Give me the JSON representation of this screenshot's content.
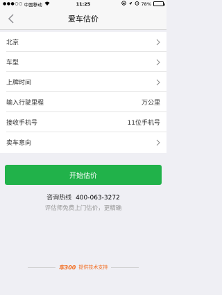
{
  "status_bar": {
    "signal": "●●●○○",
    "carrier": "中国移动",
    "wifi": "wifi-icon",
    "time": "11:25",
    "battery_text": "78%",
    "icons": [
      "lock-rotation-icon",
      "location-arrow-icon",
      "alarm-icon",
      "battery-icon"
    ]
  },
  "nav": {
    "title": "爱车估价",
    "back_icon": "chevron-left-icon"
  },
  "form": {
    "rows": [
      {
        "label": "北京",
        "value": "",
        "arrow": true
      },
      {
        "label": "车型",
        "value": "",
        "arrow": true
      },
      {
        "label": "上牌时间",
        "value": "",
        "arrow": true
      },
      {
        "label": "输入行驶里程",
        "value": "万公里",
        "arrow": false
      },
      {
        "label": "接收手机号",
        "value": "11位手机号",
        "arrow": false
      },
      {
        "label": "卖车意向",
        "value": "",
        "arrow": true
      }
    ]
  },
  "submit_label": "开始估价",
  "hotline": {
    "label": "咨询热线",
    "number": "400-063-3272"
  },
  "tip": "评估师免费上门估价，更精确",
  "footer": {
    "logo": "车300",
    "text": "提供技术支持"
  },
  "colors": {
    "accent_green": "#21b24a",
    "brand_orange": "#f26d21",
    "background": "#efeff4"
  }
}
